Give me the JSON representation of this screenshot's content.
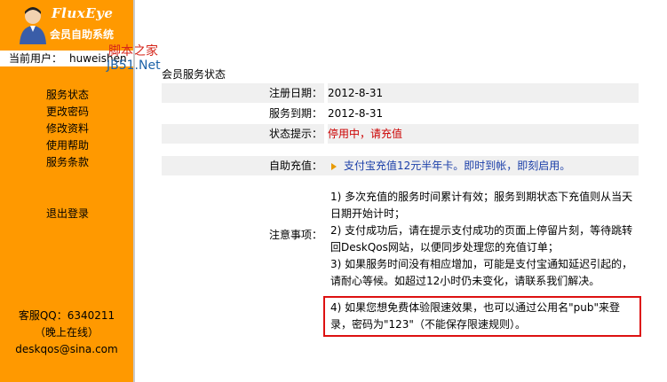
{
  "app": {
    "brand": "FluxEye",
    "subtitle": "会员自助系统"
  },
  "user": {
    "label": "当前用户：",
    "name": "huweishen"
  },
  "watermark": {
    "line1": "脚本之家",
    "line2": "JB51.Net"
  },
  "sidebar": {
    "items": [
      {
        "label": "服务状态"
      },
      {
        "label": "更改密码"
      },
      {
        "label": "修改资料"
      },
      {
        "label": "使用帮助"
      },
      {
        "label": "服务条款"
      }
    ],
    "logout": "退出登录",
    "contact": {
      "qq": "客服QQ：6340211",
      "hours": "（晚上在线）",
      "email": "deskqos@sina.com"
    }
  },
  "main": {
    "breadcrumb": "会员服务状态",
    "rows": {
      "register": {
        "label": "注册日期：",
        "value": "2012-8-31"
      },
      "expire": {
        "label": "服务到期：",
        "value": "2012-8-31"
      },
      "status": {
        "label": "状态提示：",
        "value": "停用中，请充值"
      },
      "recharge": {
        "label": "自助充值：",
        "value": "支付宝充值12元半年卡。即时到帐，即刻启用。"
      }
    },
    "notes": {
      "label": "注意事项：",
      "items": [
        "1) 多次充值的服务时间累计有效；服务到期状态下充值则从当天日期开始计时；",
        "2) 支付成功后，请在提示支付成功的页面上停留片刻，等待跳转回DeskQos网站，以便同步处理您的充值订单；",
        "3) 如果服务时间没有相应增加，可能是支付宝通知延迟引起的，请耐心等候。如超过12小时仍未变化，请联系我们解决。",
        "4) 如果您想免费体验限速效果，也可以通过公用名\"pub\"来登录，密码为\"123\"（不能保存限速规则）。"
      ]
    }
  },
  "colors": {
    "sidebar": "#ff9900",
    "status_red": "#cc0000",
    "link_blue": "#1a3ea8",
    "highlight_border": "#dd1111"
  }
}
